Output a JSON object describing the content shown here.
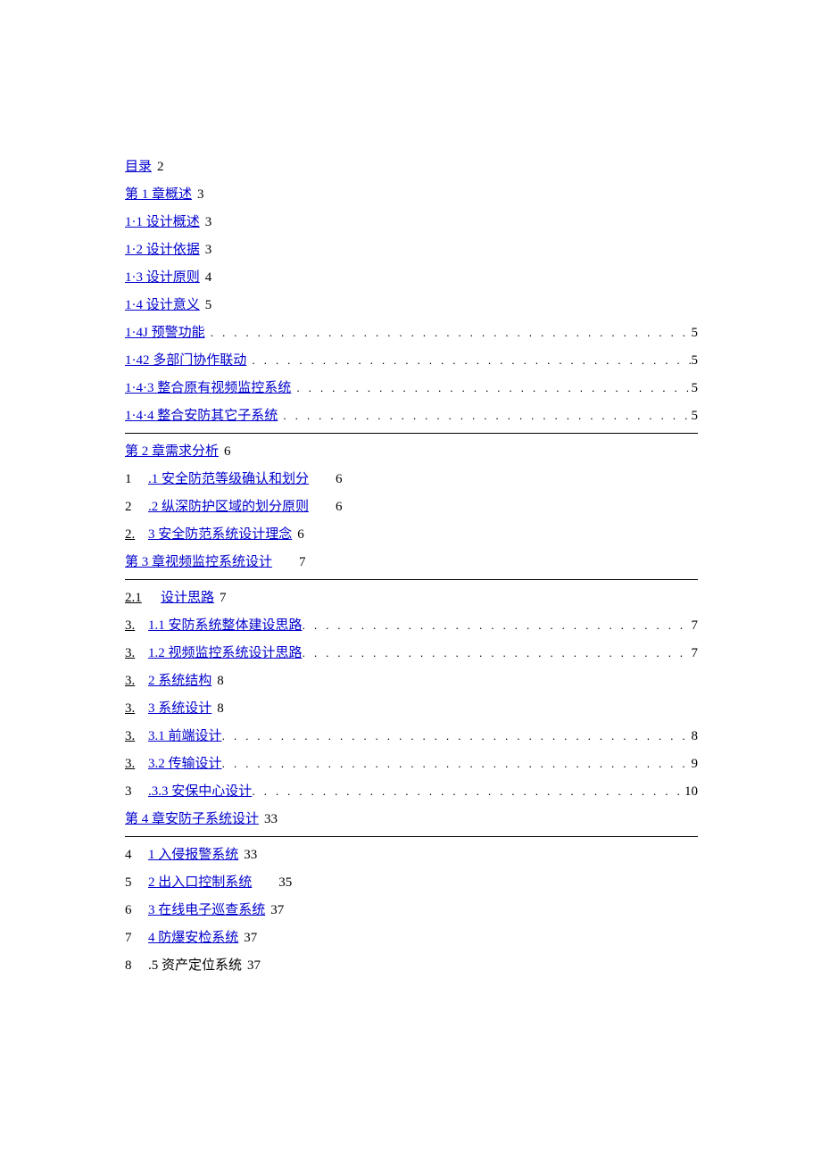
{
  "toc": {
    "e0": {
      "label": "目录",
      "page": "2"
    },
    "e1": {
      "label": "第 1 章概述",
      "page": "3"
    },
    "e2": {
      "label": "1·1 设计概述",
      "page": "3"
    },
    "e3": {
      "label": "1·2 设计依据",
      "page": "3"
    },
    "e4": {
      "label": "1·3 设计原则",
      "page": "4"
    },
    "e5": {
      "label": "1·4 设计意义",
      "page": "5"
    },
    "e6": {
      "label": "1·4J 预警功能",
      "page": "5"
    },
    "e7": {
      "label": "1·42 多部门协作联动",
      "page": "5"
    },
    "e8": {
      "label": "1·4·3 整合原有视频监控系统",
      "page": "5"
    },
    "e9": {
      "label": "1·4·4 整合安防其它子系统",
      "page": "5"
    },
    "e10": {
      "label": "第 2 章需求分析",
      "page": "6"
    },
    "e11": {
      "prefix": "1",
      "label": ".1 安全防范等级确认和划分",
      "page": "6"
    },
    "e12": {
      "prefix": "2",
      "label": ".2 纵深防护区域的划分原则",
      "page": "6"
    },
    "e13": {
      "prefix": "2.",
      "label": "3 安全防范系统设计理念",
      "page": "6"
    },
    "e14": {
      "label": "第 3 章视频监控系统设计",
      "page": "7"
    },
    "e15": {
      "prefix": "2.1",
      "label": "设计思路",
      "page": "7"
    },
    "e16": {
      "prefix": "3.",
      "label": "1.1 安防系统整体建设思路",
      "page": "7"
    },
    "e17": {
      "prefix": "3.",
      "label": "1.2 视频监控系统设计思路",
      "page": "7"
    },
    "e18": {
      "prefix": "3.",
      "label": "2 系统结构",
      "page": "8"
    },
    "e19": {
      "prefix": "3.",
      "label": "3 系统设计",
      "page": "8"
    },
    "e20": {
      "prefix": "3.",
      "label": "3.1 前端设计",
      "page": "8"
    },
    "e21": {
      "prefix": "3.",
      "label": "3.2 传输设计",
      "page": "9"
    },
    "e22": {
      "prefix": "3",
      "label": ".3.3 安保中心设计",
      "page": "10"
    },
    "e23": {
      "label": "第 4 章安防子系统设计",
      "page": "33"
    },
    "e24": {
      "prefix": "4",
      "label": "1 入侵报警系统",
      "page": "33"
    },
    "e25": {
      "prefix": "5",
      "label": "2 出入口控制系统",
      "page": "35"
    },
    "e26": {
      "prefix": "6",
      "label": "3 在线电子巡查系统",
      "page": "37"
    },
    "e27": {
      "prefix": "7",
      "label": "4 防爆安检系统",
      "page": "37"
    },
    "e28": {
      "prefix": "8",
      "label": ".5 资产定位系统",
      "page": "37"
    }
  },
  "dotfill": ". . . . . . . . . . . . . . . . . . . . . . . . . . . . . . . . . . . . . . . . . . . . . . . . . . . . . . . . . . . . . . . . . . . . . . . . . . . . . . . . . . . . . . . . . . . . . . . . . . . . . . . . ."
}
